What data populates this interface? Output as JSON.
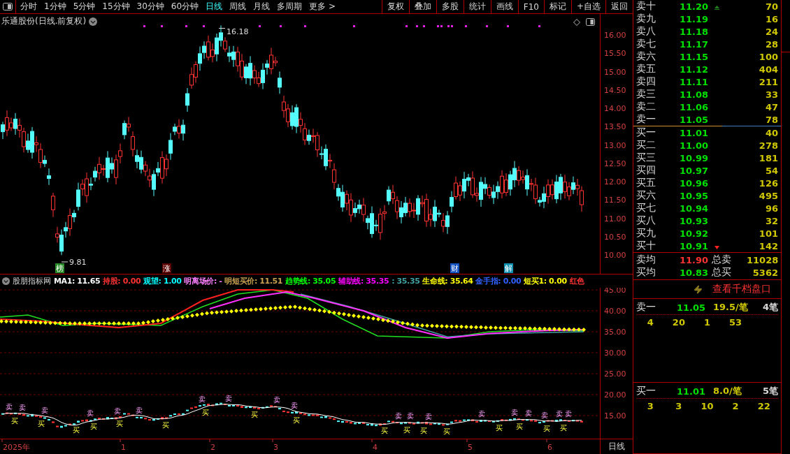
{
  "toolbar": {
    "periods": [
      {
        "label": "分时",
        "selected": false
      },
      {
        "label": "1分钟",
        "selected": false
      },
      {
        "label": "5分钟",
        "selected": false
      },
      {
        "label": "15分钟",
        "selected": false
      },
      {
        "label": "30分钟",
        "selected": false
      },
      {
        "label": "60分钟",
        "selected": false
      },
      {
        "label": "日线",
        "selected": true
      },
      {
        "label": "周线",
        "selected": false
      },
      {
        "label": "月线",
        "selected": false
      },
      {
        "label": "多周期",
        "selected": false
      },
      {
        "label": "更多 >",
        "selected": false
      }
    ],
    "buttons": [
      "复权",
      "叠加",
      "多股",
      "统计",
      "画线",
      "F10",
      "标记",
      "+自选",
      "返回"
    ]
  },
  "chart": {
    "title": "乐通股份(日线.前复权)",
    "high_label": "16.18",
    "low_label": "9.81",
    "events": [
      {
        "label": "榜",
        "color": "#2a8a2a"
      },
      {
        "label": "涨",
        "color": "#5a0000"
      },
      {
        "label": "财",
        "color": "#1050c0"
      },
      {
        "label": "解",
        "color": "#1090b0"
      }
    ],
    "price_ticks": [
      "16.00",
      "15.50",
      "15.00",
      "14.50",
      "14.00",
      "13.50",
      "13.00",
      "12.50",
      "12.00",
      "11.50",
      "11.00",
      "10.50",
      "10.00"
    ]
  },
  "indicator": {
    "name": "股朋指标网",
    "values": [
      {
        "text": "MA1: 11.65",
        "color": "#ffffff"
      },
      {
        "text": "持股: 0.00",
        "color": "#ff3232"
      },
      {
        "text": "观望: 1.00",
        "color": "#00ffff"
      },
      {
        "text": "明离场价: -",
        "color": "#ff80ff"
      },
      {
        "text": "明短买价: 11.51",
        "color": "#c8a050"
      },
      {
        "text": "趋势线: 35.05",
        "color": "#00ff00"
      },
      {
        "text": "辅助线: 35.35",
        "color": "#ff00ff"
      },
      {
        "text": ": 35.35",
        "color": "#40a0a0"
      },
      {
        "text": "生命线: 35.64",
        "color": "#ffff00"
      },
      {
        "text": "金手指: 0.00",
        "color": "#3060ff"
      },
      {
        "text": "短买1: 0.00",
        "color": "#ffff00"
      },
      {
        "text": "红色",
        "color": "#ff3232"
      }
    ],
    "ticks": [
      "45.00",
      "40.00",
      "35.00",
      "30.00",
      "25.00",
      "20.00",
      "15.00"
    ],
    "signals": [
      {
        "label": "卖",
        "kind": "sell"
      },
      {
        "label": "买",
        "kind": "buy"
      },
      {
        "label": "卖",
        "kind": "sell"
      },
      {
        "label": "买",
        "kind": "buy"
      },
      {
        "label": "卖",
        "kind": "sell"
      },
      {
        "label": "买",
        "kind": "buy"
      },
      {
        "label": "卖",
        "kind": "sell"
      },
      {
        "label": "买",
        "kind": "buy"
      },
      {
        "label": "卖",
        "kind": "sell"
      },
      {
        "label": "买",
        "kind": "buy"
      },
      {
        "label": "卖",
        "kind": "sell"
      },
      {
        "label": "买",
        "kind": "buy"
      },
      {
        "label": "卖",
        "kind": "sell"
      },
      {
        "label": "买",
        "kind": "buy"
      },
      {
        "label": "卖",
        "kind": "sell"
      },
      {
        "label": "买",
        "kind": "buy"
      },
      {
        "label": "卖",
        "kind": "sell"
      },
      {
        "label": "卖",
        "kind": "sell"
      },
      {
        "label": "买",
        "kind": "buy"
      },
      {
        "label": "买",
        "kind": "buy"
      },
      {
        "label": "卖",
        "kind": "sell"
      },
      {
        "label": "买",
        "kind": "buy"
      },
      {
        "label": "卖",
        "kind": "sell"
      },
      {
        "label": "买",
        "kind": "buy"
      },
      {
        "label": "卖",
        "kind": "sell"
      },
      {
        "label": "买",
        "kind": "buy"
      },
      {
        "label": "卖",
        "kind": "sell"
      },
      {
        "label": "买",
        "kind": "buy"
      },
      {
        "label": "卖",
        "kind": "sell"
      },
      {
        "label": "买",
        "kind": "buy"
      },
      {
        "label": "卖",
        "kind": "sell"
      },
      {
        "label": "卖",
        "kind": "sell"
      },
      {
        "label": "买",
        "kind": "buy"
      },
      {
        "label": "卖",
        "kind": "sell"
      },
      {
        "label": "买",
        "kind": "buy"
      },
      {
        "label": "卖",
        "kind": "sell"
      }
    ]
  },
  "time_axis": {
    "labels": [
      "2025年",
      "1",
      "2",
      "3",
      "4",
      "5",
      "6"
    ],
    "period": "日线"
  },
  "order_book": {
    "asks": [
      {
        "label": "卖十",
        "price": "11.20",
        "volume": "70"
      },
      {
        "label": "卖九",
        "price": "11.19",
        "volume": "16"
      },
      {
        "label": "卖八",
        "price": "11.18",
        "volume": "24"
      },
      {
        "label": "卖七",
        "price": "11.17",
        "volume": "28"
      },
      {
        "label": "卖六",
        "price": "11.15",
        "volume": "100"
      },
      {
        "label": "卖五",
        "price": "11.12",
        "volume": "404"
      },
      {
        "label": "卖四",
        "price": "11.11",
        "volume": "211"
      },
      {
        "label": "卖三",
        "price": "11.08",
        "volume": "33"
      },
      {
        "label": "卖二",
        "price": "11.06",
        "volume": "47"
      },
      {
        "label": "卖一",
        "price": "11.05",
        "volume": "78"
      }
    ],
    "bids": [
      {
        "label": "买一",
        "price": "11.01",
        "volume": "40"
      },
      {
        "label": "买二",
        "price": "11.00",
        "volume": "278"
      },
      {
        "label": "买三",
        "price": "10.99",
        "volume": "181"
      },
      {
        "label": "买四",
        "price": "10.97",
        "volume": "54"
      },
      {
        "label": "买五",
        "price": "10.96",
        "volume": "126"
      },
      {
        "label": "买六",
        "price": "10.95",
        "volume": "495"
      },
      {
        "label": "买七",
        "price": "10.94",
        "volume": "96"
      },
      {
        "label": "买八",
        "price": "10.93",
        "volume": "32"
      },
      {
        "label": "买九",
        "price": "10.92",
        "volume": "101"
      },
      {
        "label": "买十",
        "price": "10.91",
        "volume": "142"
      }
    ],
    "summary": [
      {
        "label": "卖均",
        "price": "11.90",
        "color": "#ff3232",
        "total_label": "总卖",
        "total": "11028"
      },
      {
        "label": "买均",
        "price": "10.83",
        "color": "#00e000",
        "total_label": "总买",
        "total": "5362"
      }
    ]
  },
  "depth_link": "查看千档盘口",
  "trades": [
    {
      "label": "卖一",
      "price": "11.05",
      "average": "19.5/笔",
      "count": "4笔",
      "orders": [
        "4",
        "20",
        "1",
        "53"
      ]
    },
    {
      "label": "买一",
      "price": "11.01",
      "average": "8.0/笔",
      "count": "5笔",
      "orders": [
        "3",
        "3",
        "10",
        "2",
        "22"
      ]
    }
  ]
}
